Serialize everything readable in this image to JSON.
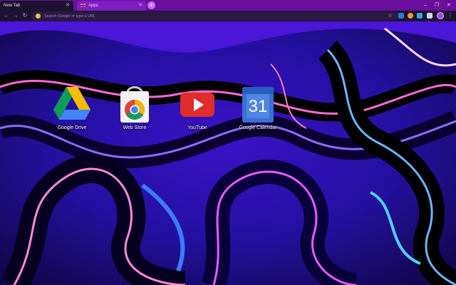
{
  "tabs": [
    {
      "label": "New Tab",
      "active": true
    },
    {
      "label": "Apps",
      "active": false
    }
  ],
  "omnibox": {
    "placeholder": "Search Google or type a URL"
  },
  "apps": [
    {
      "label": "Google Drive",
      "icon": "google-drive-icon"
    },
    {
      "label": "Web Store",
      "icon": "chrome-web-store-icon"
    },
    {
      "label": "YouTube",
      "icon": "youtube-icon"
    },
    {
      "label": "Google Calendar",
      "icon": "google-calendar-icon",
      "calendar_day": "31"
    }
  ],
  "theme": {
    "accent": "#6a0f9c",
    "toolbar": "#1d1230",
    "wallpaper": "purple-blue swirl"
  }
}
